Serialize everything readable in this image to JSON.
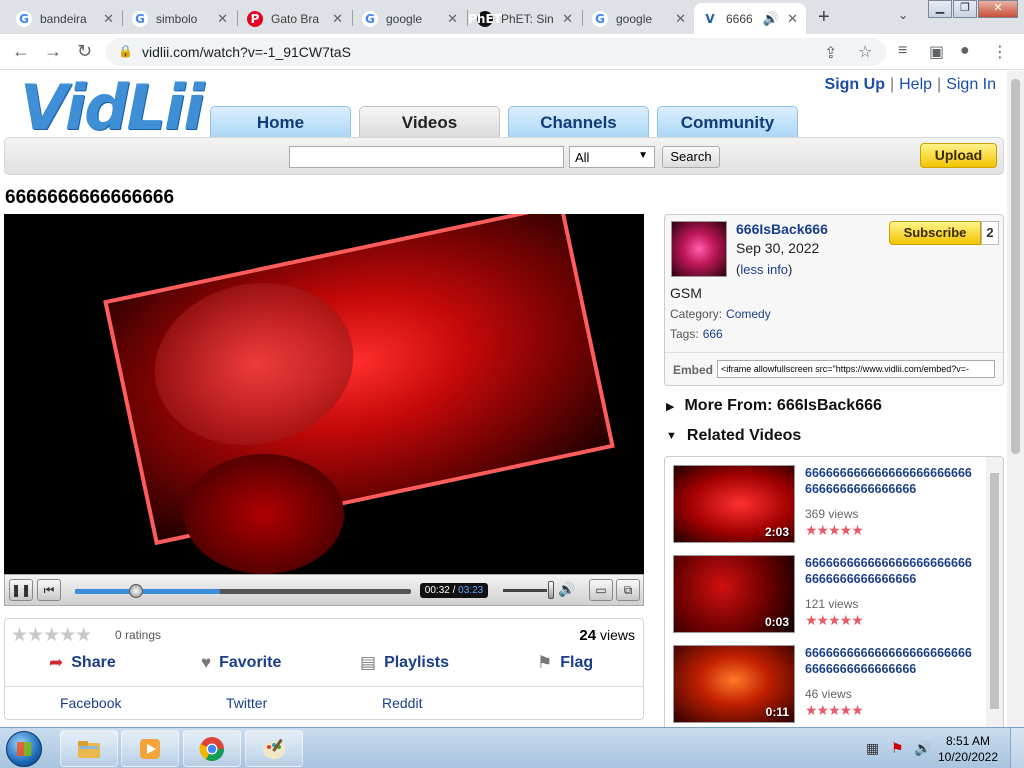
{
  "browser": {
    "tabs": [
      {
        "title": "bandeira",
        "icon": "google-icon"
      },
      {
        "title": "simbolo",
        "icon": "google-icon"
      },
      {
        "title": "Gato Bra",
        "icon": "pinterest-icon"
      },
      {
        "title": "google",
        "icon": "google-icon"
      },
      {
        "title": "PhET: Sin",
        "icon": "phet-icon"
      },
      {
        "title": "google",
        "icon": "google-icon"
      },
      {
        "title": "6666",
        "icon": "vidlii-icon",
        "active": true
      }
    ],
    "url": "vidlii.com/watch?v=-1_91CW7taS"
  },
  "site": {
    "logo": "VidLii",
    "top_links": {
      "sign_up": "Sign Up",
      "help": "Help",
      "sign_in": "Sign In"
    },
    "nav": [
      "Home",
      "Videos",
      "Channels",
      "Community"
    ],
    "nav_selected": "Videos",
    "search": {
      "value": "",
      "category": "All",
      "button": "Search"
    },
    "upload": "Upload"
  },
  "video": {
    "title": "6666666666666666",
    "current_time": "00:32",
    "duration": "03:23",
    "progress": 0.16,
    "volume": 0.88,
    "ratings": "0 ratings",
    "views_count": "24",
    "views_label": "views",
    "actions": {
      "share": "Share",
      "favorite": "Favorite",
      "playlists": "Playlists",
      "flag": "Flag"
    },
    "share_links": [
      "Facebook",
      "Twitter",
      "Reddit"
    ]
  },
  "uploader": {
    "name": "666IsBack666",
    "date": "Sep 30, 2022",
    "less_info": "less info",
    "subscribe": "Subscribe",
    "subscriber_count": "2",
    "description": "GSM",
    "category_label": "Category:",
    "category": "Comedy",
    "tags_label": "Tags:",
    "tags": "666",
    "embed_label": "Embed",
    "embed_code": "<iframe allowfullscreen src=\"https://www.vidlii.com/embed?v=-"
  },
  "sections": {
    "more_from": "More From: 666IsBack666",
    "related": "Related Videos"
  },
  "related_videos": [
    {
      "title": "6666666666666666666666666666666666666666",
      "views": "369 views",
      "duration": "2:03"
    },
    {
      "title": "6666666666666666666666666666666666666666",
      "views": "121 views",
      "duration": "0:03"
    },
    {
      "title": "6666666666666666666666666666666666666666",
      "views": "46 views",
      "duration": "0:11"
    }
  ],
  "taskbar": {
    "time": "8:51 AM",
    "date": "10/20/2022"
  },
  "colors": {
    "link": "#1a3e8c",
    "nav_tab": "#a9d6f6",
    "button_yellow": "#f2c500",
    "seek_fill": "#3a8edb"
  }
}
